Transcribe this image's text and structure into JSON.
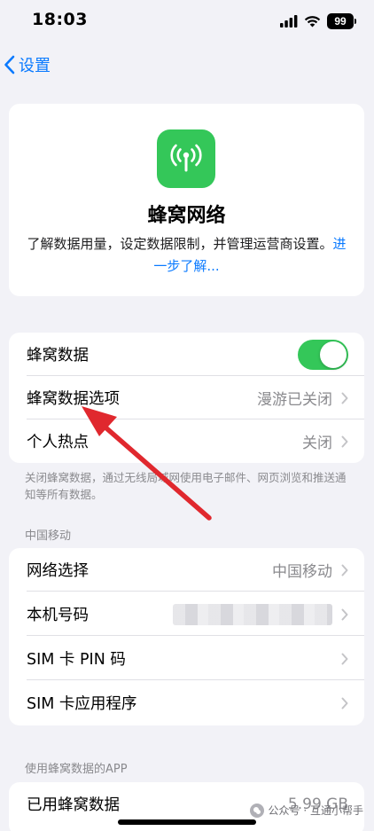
{
  "status_bar": {
    "time": "18:03",
    "battery": "99"
  },
  "nav": {
    "back_label": "设置"
  },
  "hero": {
    "title": "蜂窝网络",
    "description": "了解数据用量，设定数据限制，并管理运营商设置。",
    "link": "进一步了解..."
  },
  "group1": {
    "rows": [
      {
        "label": "蜂窝数据",
        "toggle": true
      },
      {
        "label": "蜂窝数据选项",
        "value": "漫游已关闭"
      },
      {
        "label": "个人热点",
        "value": "关闭"
      }
    ],
    "footer": "关闭蜂窝数据，通过无线局域网使用电子邮件、网页浏览和推送通知等所有数据。"
  },
  "group2": {
    "header": "中国移动",
    "rows": [
      {
        "label": "网络选择",
        "value": "中国移动"
      },
      {
        "label": "本机号码",
        "value": ""
      },
      {
        "label": "SIM 卡 PIN 码"
      },
      {
        "label": "SIM 卡应用程序"
      }
    ]
  },
  "group3": {
    "header": "使用蜂窝数据的APP",
    "rows": [
      {
        "label": "已用蜂窝数据",
        "value": "5.99 GB"
      }
    ]
  },
  "watermark": "公众号 · 互通小帮手",
  "colors": {
    "accent": "#0a7aff",
    "green": "#34c759",
    "annotation_arrow": "#e0282e"
  }
}
